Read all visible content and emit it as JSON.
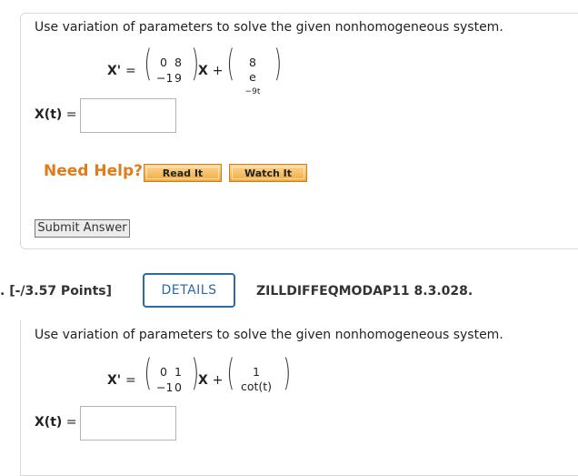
{
  "q1": {
    "prompt": "Use variation of parameters to solve the given nonhomogeneous system.",
    "lhs": "X'",
    "equals": "=",
    "matrix": [
      "0",
      "8",
      "−1",
      "9"
    ],
    "x_symbol": "X",
    "plus": "+",
    "forcing": [
      "8",
      "e",
      "−9t"
    ],
    "answer_label": "X(t)",
    "answer_equals": "=",
    "answer_value": "",
    "need_help": "Need Help?",
    "read_it": "Read It",
    "watch_it": "Watch It",
    "submit": "Submit Answer"
  },
  "q2_header": {
    "points": ". [-/3.57 Points]",
    "details": "DETAILS",
    "question_id": "ZILLDIFFEQMODAP11 8.3.028."
  },
  "q2": {
    "prompt": "Use variation of parameters to solve the given nonhomogeneous system.",
    "lhs": "X'",
    "equals": "=",
    "matrix": [
      "0",
      "1",
      "−1",
      "0"
    ],
    "x_symbol": "X",
    "plus": "+",
    "forcing": [
      "1",
      "cot(t)"
    ],
    "answer_label": "X(t)",
    "answer_equals": "=",
    "answer_value": ""
  }
}
